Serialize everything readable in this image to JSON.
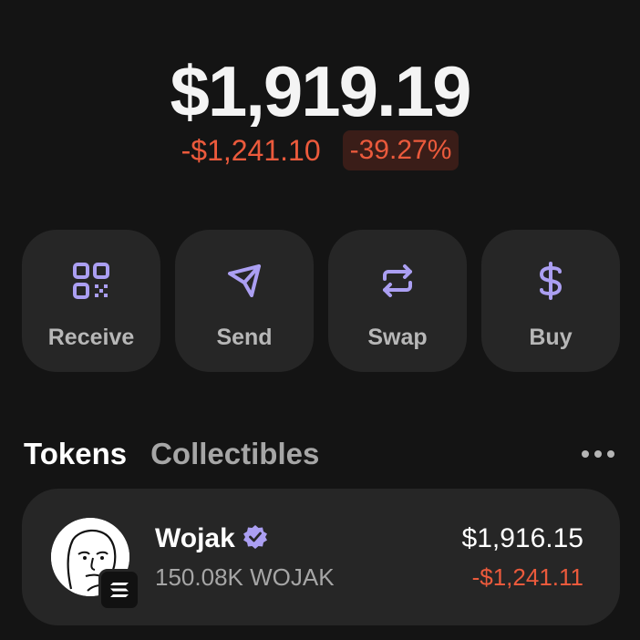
{
  "balance": {
    "total": "$1,919.19",
    "change_amount": "-$1,241.10",
    "change_percent": "-39.27%"
  },
  "actions": [
    {
      "label": "Receive",
      "icon": "qr-code-icon"
    },
    {
      "label": "Send",
      "icon": "send-icon"
    },
    {
      "label": "Swap",
      "icon": "swap-icon"
    },
    {
      "label": "Buy",
      "icon": "dollar-icon"
    }
  ],
  "tabs": [
    {
      "label": "Tokens",
      "active": true
    },
    {
      "label": "Collectibles",
      "active": false
    }
  ],
  "tokens": [
    {
      "name": "Wojak",
      "verified": true,
      "amount": "150.08K WOJAK",
      "value": "$1,916.15",
      "change": "-$1,241.11",
      "avatar_icon": "wojak-avatar-icon",
      "chain_icon": "solana-icon"
    }
  ],
  "colors": {
    "background": "#141414",
    "card": "#262626",
    "accent": "#ab9ff2",
    "negative": "#eb5a3c",
    "muted_text": "#a6a6a6"
  }
}
